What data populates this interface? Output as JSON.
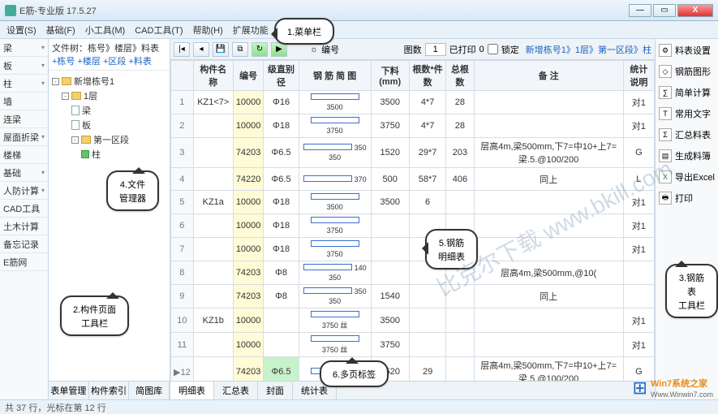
{
  "app": {
    "title": "E筋-专业版 17.5.27"
  },
  "menubar": [
    "设置(S)",
    "基础(F)",
    "小工具(M)",
    "CAD工具(T)",
    "帮助(H)",
    "扩展功能"
  ],
  "leftnav": [
    "梁",
    "板",
    "柱",
    "墙",
    "连梁",
    "屋面折梁",
    "楼梯",
    "基础",
    "人防计算",
    "CAD工具",
    "土木计算",
    "备忘记录",
    "E筋网"
  ],
  "treehdr": {
    "label": "文件树：",
    "path": "栋号》楼层》料表",
    "add": "+栋号 +楼层 +区段 +料表"
  },
  "tree": {
    "root": "新增栋号1",
    "floor": "1层",
    "items": [
      "梁",
      "板"
    ],
    "section": "第一区段",
    "leaf": "柱"
  },
  "treetabs": [
    "表单管理",
    "构件索引",
    "简图库"
  ],
  "toolbar": {
    "page_lbl": "图数",
    "page_val": "1",
    "printed_lbl": "已打印",
    "printed_val": "0",
    "lock_lbl": "锁定",
    "crumb": "新增栋号1》1层》第一区段》柱",
    "hint": "编号"
  },
  "columns": [
    "",
    "构件名称",
    "编号",
    "级直别径",
    "钢 筋 简 图",
    "下料(mm)",
    "根数*件数",
    "总根数",
    "备  注",
    "统计说明"
  ],
  "rows": [
    {
      "no": "1",
      "name": "KZ1<7>",
      "code": "10000",
      "spec": "Φ16",
      "dia": "3500",
      "len": "3500",
      "qty": "4*7",
      "tot": "28",
      "note": "",
      "stat": "对1"
    },
    {
      "no": "2",
      "name": "",
      "code": "10000",
      "spec": "Φ18",
      "dia": "3750",
      "len": "3750",
      "qty": "4*7",
      "tot": "28",
      "note": "",
      "stat": "对1"
    },
    {
      "no": "3",
      "name": "",
      "code": "74203",
      "spec": "Φ6.5",
      "dia": "350 350",
      "len": "1520",
      "qty": "29*7",
      "tot": "203",
      "note": "层高4m,梁500mm,下7=中10+上7=梁.5.@100/200",
      "stat": "G"
    },
    {
      "no": "4",
      "name": "",
      "code": "74220",
      "spec": "Φ6.5",
      "dia": "370",
      "len": "500",
      "qty": "58*7",
      "tot": "406",
      "note": "同上",
      "stat": "L"
    },
    {
      "no": "5",
      "name": "KZ1a",
      "code": "10000",
      "spec": "Φ18",
      "dia": "3500",
      "len": "3500",
      "qty": "6",
      "tot": "",
      "note": "",
      "stat": "对1"
    },
    {
      "no": "6",
      "name": "",
      "code": "10000",
      "spec": "Φ18",
      "dia": "3750",
      "len": "",
      "qty": "",
      "tot": "",
      "note": "",
      "stat": "对1"
    },
    {
      "no": "7",
      "name": "",
      "code": "10000",
      "spec": "Φ18",
      "dia": "3750",
      "len": "",
      "qty": "",
      "tot": "",
      "note": "",
      "stat": "对1"
    },
    {
      "no": "8",
      "name": "",
      "code": "74203",
      "spec": "Φ8",
      "dia": "140 350",
      "len": "",
      "qty": "",
      "tot": "",
      "note": "层高4m,梁500mm,@10(",
      "stat": ""
    },
    {
      "no": "9",
      "name": "",
      "code": "74203",
      "spec": "Φ8",
      "dia": "350 350",
      "len": "1540",
      "qty": "",
      "tot": "",
      "note": "同上",
      "stat": ""
    },
    {
      "no": "10",
      "name": "KZ1b",
      "code": "10000",
      "spec": "",
      "dia": "3750 丝",
      "len": "3500",
      "qty": "",
      "tot": "",
      "note": "",
      "stat": "对1"
    },
    {
      "no": "11",
      "name": "",
      "code": "10000",
      "spec": "",
      "dia": "3750 丝",
      "len": "3750",
      "qty": "",
      "tot": "",
      "note": "",
      "stat": "对1"
    },
    {
      "no": "▶12",
      "name": "",
      "code": "74203",
      "spec": "Φ6.5",
      "dia": "",
      "len": "1520",
      "qty": "29",
      "tot": "",
      "note": "层高4m,梁500mm,下7=中10+上7=梁.5.@100/200",
      "stat": "G"
    }
  ],
  "bottomtabs": [
    "明细表",
    "汇总表",
    "封面",
    "统计表"
  ],
  "rightbar": [
    "料表设置",
    "钢筋图形",
    "简单计算",
    "常用文字",
    "汇总料表",
    "生成料簿",
    "导出Excel",
    "打印"
  ],
  "status": "共 37 行，光标在第 12 行",
  "callouts": {
    "c1": "1.菜单栏",
    "c2": "4.文件\n管理器",
    "c3": "3.钢筋表\n工具栏",
    "c4": "2.构件页面\n工具栏",
    "c5": "5.钢筋\n明细表",
    "c6": "6.多页标签"
  },
  "watermark": "比克尔下载 www.bkill.com",
  "brand": {
    "name": "Win7系统之家",
    "url": "Www.Winwin7.com"
  }
}
